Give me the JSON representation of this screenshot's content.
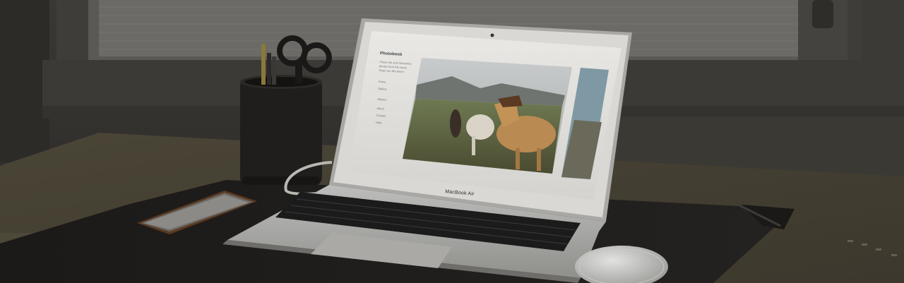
{
  "scene": {
    "laptop": {
      "brand_label": "MacBook Air",
      "screen": {
        "app_title": "Photobook",
        "intro_lines": [
          "Those are your favourites",
          "photos from this week.",
          "Hope you like them!"
        ],
        "menu_items": [
          "Home",
          "Gallery",
          "Albums",
          "About",
          "Contact",
          "Help"
        ]
      }
    }
  }
}
